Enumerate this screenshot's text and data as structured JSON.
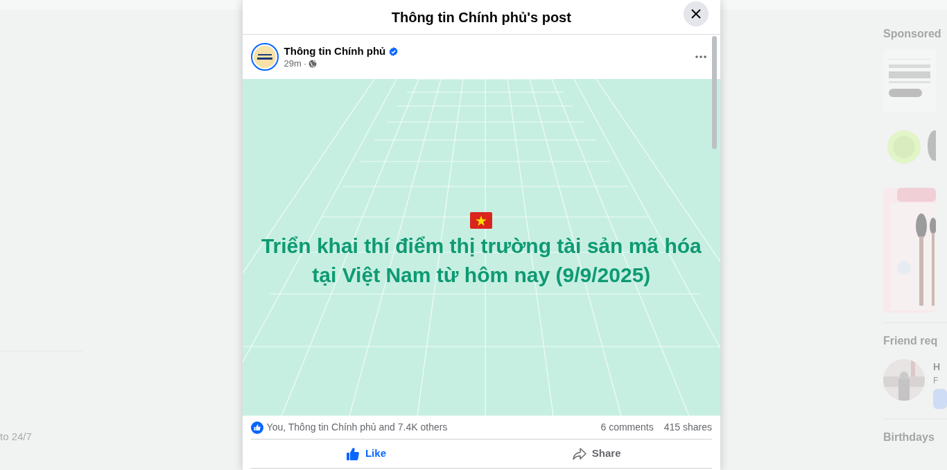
{
  "background": {
    "left_text": "to 24/7",
    "sidebar": {
      "sponsored_heading": "Sponsored",
      "friend_requests_heading": "Friend req",
      "friend_request": {
        "name": "H",
        "detail": "F"
      },
      "birthdays_heading": "Birthdays"
    }
  },
  "modal": {
    "title": "Thông tin Chính phủ's post",
    "post": {
      "author": "Thông tin Chính phủ",
      "verified": true,
      "time": "29m",
      "separator": "·",
      "image": {
        "headline": [
          "Triển khai thí điểm thị trường tài sản mã hóa",
          "tại Việt Nam từ hôm nay (9/9/2025)"
        ]
      },
      "reactions": "You, Thông tin Chính phủ and 7.4K others",
      "comments": "6 comments",
      "shares": "415 shares",
      "actions": [
        {
          "kind": "like",
          "label": "Like",
          "selected": true
        },
        {
          "kind": "share",
          "label": "Share",
          "selected": false
        }
      ]
    }
  }
}
